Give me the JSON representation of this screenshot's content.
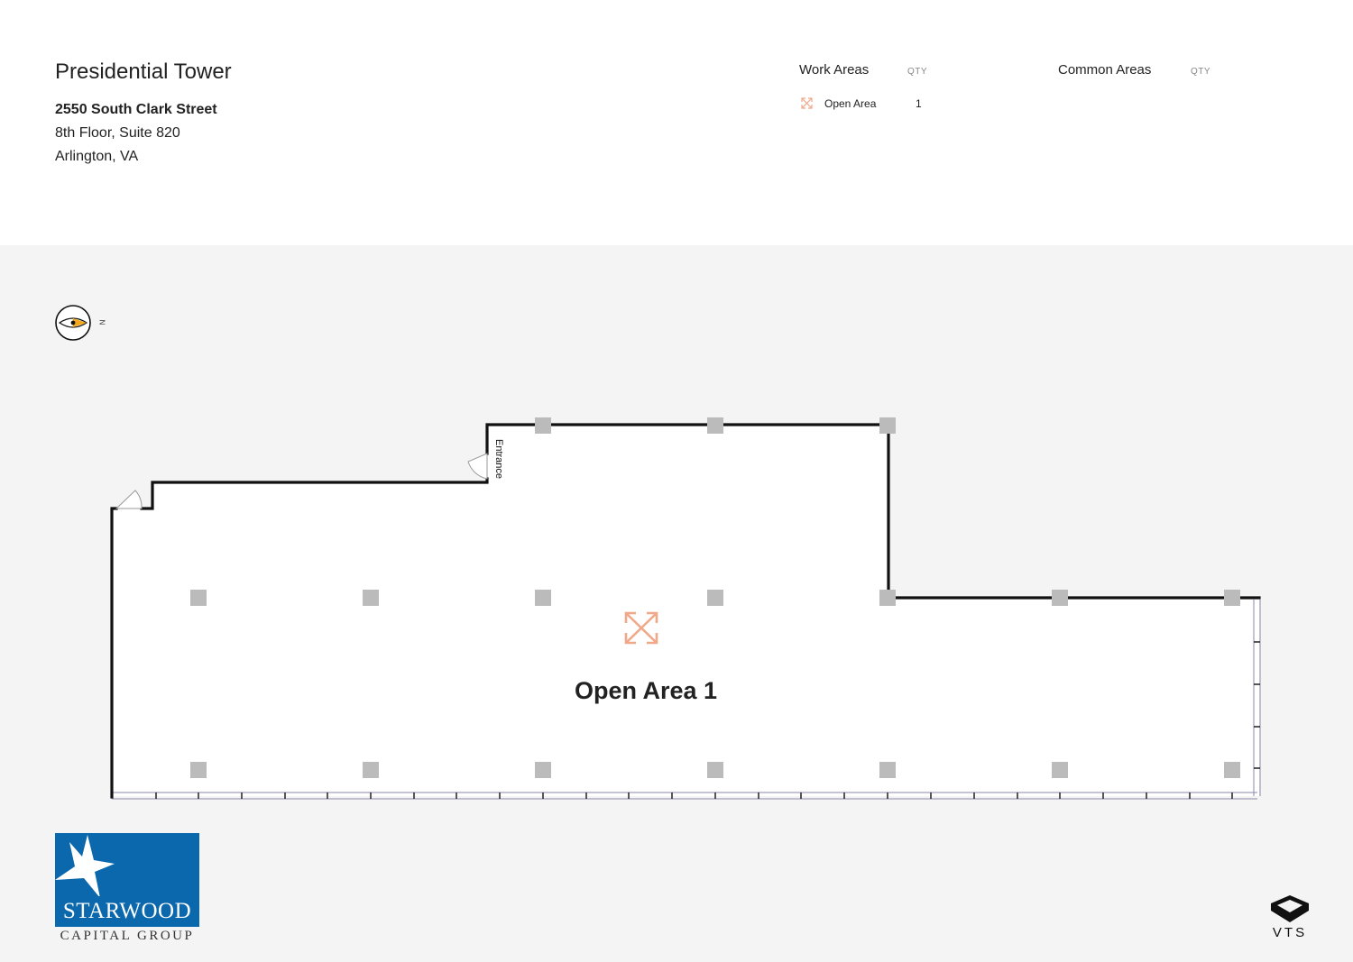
{
  "header": {
    "building": "Presidential Tower",
    "street": "2550 South Clark Street",
    "suite": "8th Floor, Suite 820",
    "city": "Arlington, VA"
  },
  "legend": {
    "work_areas_title": "Work Areas",
    "work_qty_title": "QTY",
    "common_areas_title": "Common Areas",
    "common_qty_title": "QTY",
    "items": [
      {
        "label": "Open Area",
        "qty": "1",
        "icon": "expand-arrows-icon",
        "color": "#f0a888"
      }
    ]
  },
  "compass": {
    "north_label": "N"
  },
  "plan": {
    "area_label": "Open Area 1",
    "entrance_label": "Entrance",
    "wall_color": "#111111",
    "column_color": "#bbbbbb",
    "background_color": "#f4f4f4"
  },
  "branding": {
    "landlord_word": "STARWOOD",
    "landlord_sub": "CAPITAL GROUP",
    "landlord_color": "#0b68ac",
    "platform": "VTS"
  }
}
